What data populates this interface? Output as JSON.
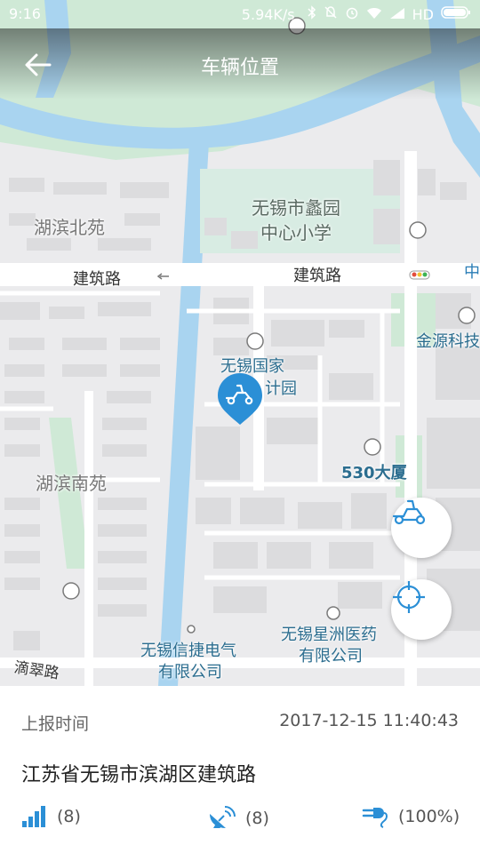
{
  "status_bar": {
    "time": "9:16",
    "net_speed": "5.94K/s",
    "network_type": "HD",
    "icons": [
      "bluetooth-icon",
      "mute-icon",
      "alarm-icon",
      "wifi-icon",
      "signal-icon",
      "battery-icon"
    ]
  },
  "header": {
    "title": "车辆位置"
  },
  "map": {
    "labels": {
      "school": "无锡市蠡园\n中心小学",
      "hubin_north": "湖滨北苑",
      "jianzhu_road_1": "建筑路",
      "jianzhu_road_2": "建筑路",
      "zhong": "中",
      "jinyuan": "金源科技",
      "wuxi_guojia": "无锡国家",
      "jiyuan": "计园",
      "tower_530": "530大厦",
      "hubin_south": "湖滨南苑",
      "xinjie_line1": "无锡信捷电气",
      "xinjie_line2": "有限公司",
      "xingzhou_line1": "无锡星洲医药",
      "xingzhou_line2": "有限公司",
      "dicui_road": "滴翠路"
    },
    "accent_color": "#2b8fd6"
  },
  "info": {
    "report_label": "上报时间",
    "report_time": "2017-12-15 11:40:43",
    "address": "江苏省无锡市滨湖区建筑路",
    "signal_value": "(8)",
    "satellite_value": "(8)",
    "battery_value": "(100%)"
  }
}
